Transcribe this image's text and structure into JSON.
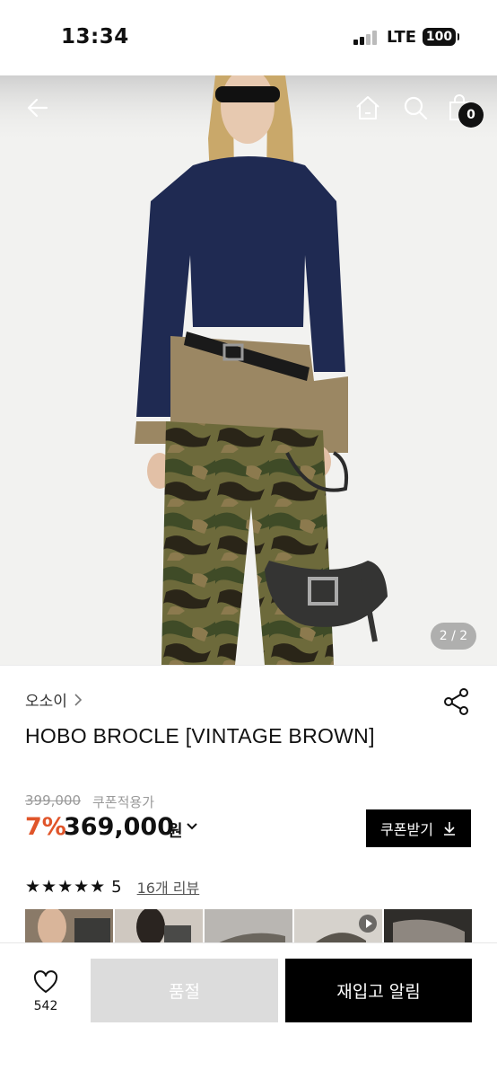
{
  "status": {
    "time": "13:34",
    "network": "LTE",
    "battery": "100"
  },
  "header": {
    "cart_count": "0"
  },
  "gallery": {
    "indicator": "2 / 2"
  },
  "product": {
    "brand": "오소이",
    "name": "HOBO BROCLE [VINTAGE BROWN]",
    "original_price": "399,000",
    "coupon_note": "쿠폰적용가",
    "discount": "7%",
    "price": "369,000",
    "currency": "원",
    "coupon_button": "쿠폰받기"
  },
  "reviews": {
    "stars": "★★★★★",
    "rating": "5",
    "link": "16개 리뷰"
  },
  "footer": {
    "like_count": "542",
    "soldout_label": "품절",
    "restock_label": "재입고 알림"
  },
  "colors": {
    "discount": "#e0552a",
    "primary": "#000000",
    "disabled": "#dcdcdc"
  },
  "icons": [
    "back-arrow-icon",
    "home-icon",
    "search-icon",
    "shopping-bag-icon",
    "share-icon",
    "chevron-right-icon",
    "chevron-down-icon",
    "download-icon",
    "heart-icon",
    "play-icon"
  ]
}
